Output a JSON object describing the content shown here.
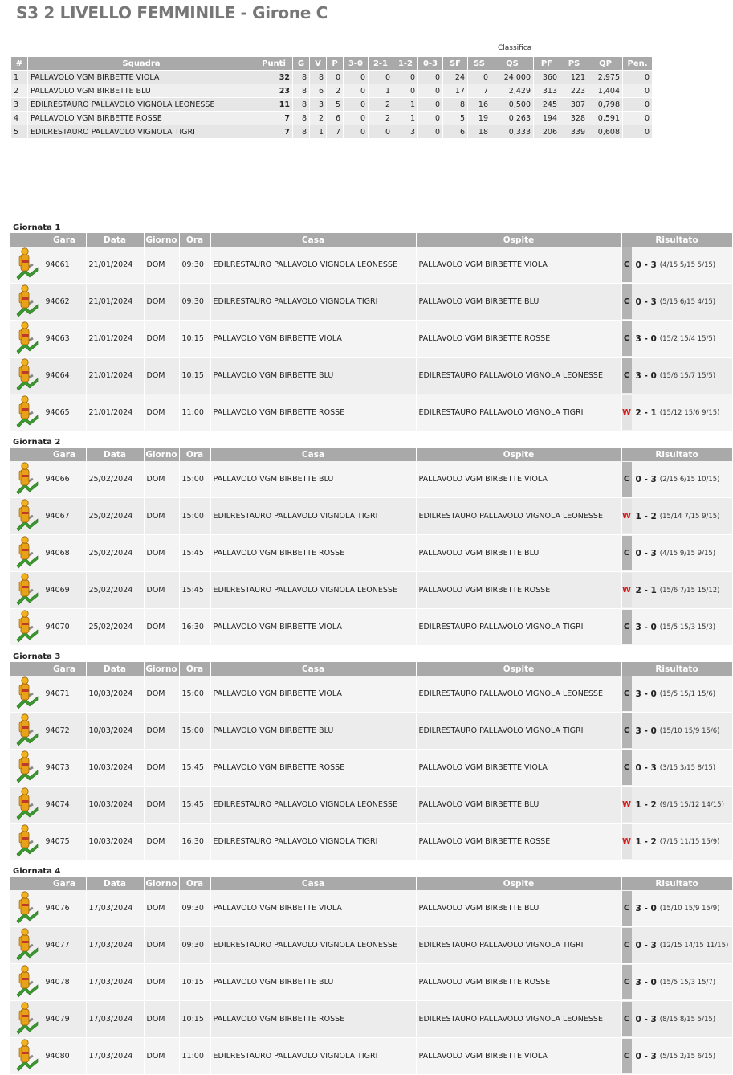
{
  "title": "S3 2 LIVELLO FEMMINILE - Girone C",
  "classifica": {
    "caption": "Classifica",
    "headers": [
      "#",
      "Squadra",
      "Punti",
      "G",
      "V",
      "P",
      "3-0",
      "2-1",
      "1-2",
      "0-3",
      "SF",
      "SS",
      "QS",
      "PF",
      "PS",
      "QP",
      "Pen."
    ],
    "rows": [
      [
        "1",
        "PALLAVOLO VGM BIRBETTE VIOLA",
        "32",
        "8",
        "8",
        "0",
        "0",
        "0",
        "0",
        "0",
        "24",
        "0",
        "24,000",
        "360",
        "121",
        "2,975",
        "0"
      ],
      [
        "2",
        "PALLAVOLO VGM BIRBETTE BLU",
        "23",
        "8",
        "6",
        "2",
        "0",
        "1",
        "0",
        "0",
        "17",
        "7",
        "2,429",
        "313",
        "223",
        "1,404",
        "0"
      ],
      [
        "3",
        "EDILRESTAURO PALLAVOLO VIGNOLA LEONESSE",
        "11",
        "8",
        "3",
        "5",
        "0",
        "2",
        "1",
        "0",
        "8",
        "16",
        "0,500",
        "245",
        "307",
        "0,798",
        "0"
      ],
      [
        "4",
        "PALLAVOLO VGM BIRBETTE ROSSE",
        "7",
        "8",
        "2",
        "6",
        "0",
        "2",
        "1",
        "0",
        "5",
        "19",
        "0,263",
        "194",
        "328",
        "0,591",
        "0"
      ],
      [
        "5",
        "EDILRESTAURO PALLAVOLO VIGNOLA TIGRI",
        "7",
        "8",
        "1",
        "7",
        "0",
        "0",
        "3",
        "0",
        "6",
        "18",
        "0,333",
        "206",
        "339",
        "0,608",
        "0"
      ]
    ]
  },
  "calendar_headers": [
    "",
    "Gara",
    "Data",
    "Giorno",
    "Ora",
    "Casa",
    "Ospite",
    "Risultato"
  ],
  "giornate": [
    {
      "title": "Giornata 1",
      "matches": [
        {
          "gara": "94061",
          "data": "21/01/2024",
          "giorno": "DOM",
          "ora": "09:30",
          "casa": "EDILRESTAURO PALLAVOLO VIGNOLA LEONESSE",
          "ospite": "PALLAVOLO VGM BIRBETTE VIOLA",
          "tag": "C",
          "score": "0 - 3",
          "sets": "(4/15 5/15 5/15)"
        },
        {
          "gara": "94062",
          "data": "21/01/2024",
          "giorno": "DOM",
          "ora": "09:30",
          "casa": "EDILRESTAURO PALLAVOLO VIGNOLA TIGRI",
          "ospite": "PALLAVOLO VGM BIRBETTE BLU",
          "tag": "C",
          "score": "0 - 3",
          "sets": "(5/15 6/15 4/15)"
        },
        {
          "gara": "94063",
          "data": "21/01/2024",
          "giorno": "DOM",
          "ora": "10:15",
          "casa": "PALLAVOLO VGM BIRBETTE VIOLA",
          "ospite": "PALLAVOLO VGM BIRBETTE ROSSE",
          "tag": "C",
          "score": "3 - 0",
          "sets": "(15/2 15/4 15/5)"
        },
        {
          "gara": "94064",
          "data": "21/01/2024",
          "giorno": "DOM",
          "ora": "10:15",
          "casa": "PALLAVOLO VGM BIRBETTE BLU",
          "ospite": "EDILRESTAURO PALLAVOLO VIGNOLA LEONESSE",
          "tag": "C",
          "score": "3 - 0",
          "sets": "(15/6 15/7 15/5)"
        },
        {
          "gara": "94065",
          "data": "21/01/2024",
          "giorno": "DOM",
          "ora": "11:00",
          "casa": "PALLAVOLO VGM BIRBETTE ROSSE",
          "ospite": "EDILRESTAURO PALLAVOLO VIGNOLA TIGRI",
          "tag": "W",
          "score": "2 - 1",
          "sets": "(15/12 15/6 9/15)"
        }
      ]
    },
    {
      "title": "Giornata 2",
      "matches": [
        {
          "gara": "94066",
          "data": "25/02/2024",
          "giorno": "DOM",
          "ora": "15:00",
          "casa": "PALLAVOLO VGM BIRBETTE BLU",
          "ospite": "PALLAVOLO VGM BIRBETTE VIOLA",
          "tag": "C",
          "score": "0 - 3",
          "sets": "(2/15 6/15 10/15)"
        },
        {
          "gara": "94067",
          "data": "25/02/2024",
          "giorno": "DOM",
          "ora": "15:00",
          "casa": "EDILRESTAURO PALLAVOLO VIGNOLA TIGRI",
          "ospite": "EDILRESTAURO PALLAVOLO VIGNOLA LEONESSE",
          "tag": "W",
          "score": "1 - 2",
          "sets": "(15/14 7/15 9/15)"
        },
        {
          "gara": "94068",
          "data": "25/02/2024",
          "giorno": "DOM",
          "ora": "15:45",
          "casa": "PALLAVOLO VGM BIRBETTE ROSSE",
          "ospite": "PALLAVOLO VGM BIRBETTE BLU",
          "tag": "C",
          "score": "0 - 3",
          "sets": "(4/15 9/15 9/15)"
        },
        {
          "gara": "94069",
          "data": "25/02/2024",
          "giorno": "DOM",
          "ora": "15:45",
          "casa": "EDILRESTAURO PALLAVOLO VIGNOLA LEONESSE",
          "ospite": "PALLAVOLO VGM BIRBETTE ROSSE",
          "tag": "W",
          "score": "2 - 1",
          "sets": "(15/6 7/15 15/12)"
        },
        {
          "gara": "94070",
          "data": "25/02/2024",
          "giorno": "DOM",
          "ora": "16:30",
          "casa": "PALLAVOLO VGM BIRBETTE VIOLA",
          "ospite": "EDILRESTAURO PALLAVOLO VIGNOLA TIGRI",
          "tag": "C",
          "score": "3 - 0",
          "sets": "(15/5 15/3 15/3)"
        }
      ]
    },
    {
      "title": "Giornata 3",
      "matches": [
        {
          "gara": "94071",
          "data": "10/03/2024",
          "giorno": "DOM",
          "ora": "15:00",
          "casa": "PALLAVOLO VGM BIRBETTE VIOLA",
          "ospite": "EDILRESTAURO PALLAVOLO VIGNOLA LEONESSE",
          "tag": "C",
          "score": "3 - 0",
          "sets": "(15/5 15/1 15/6)"
        },
        {
          "gara": "94072",
          "data": "10/03/2024",
          "giorno": "DOM",
          "ora": "15:00",
          "casa": "PALLAVOLO VGM BIRBETTE BLU",
          "ospite": "EDILRESTAURO PALLAVOLO VIGNOLA TIGRI",
          "tag": "C",
          "score": "3 - 0",
          "sets": "(15/10 15/9 15/6)"
        },
        {
          "gara": "94073",
          "data": "10/03/2024",
          "giorno": "DOM",
          "ora": "15:45",
          "casa": "PALLAVOLO VGM BIRBETTE ROSSE",
          "ospite": "PALLAVOLO VGM BIRBETTE VIOLA",
          "tag": "C",
          "score": "0 - 3",
          "sets": "(3/15 3/15 8/15)"
        },
        {
          "gara": "94074",
          "data": "10/03/2024",
          "giorno": "DOM",
          "ora": "15:45",
          "casa": "EDILRESTAURO PALLAVOLO VIGNOLA LEONESSE",
          "ospite": "PALLAVOLO VGM BIRBETTE BLU",
          "tag": "W",
          "score": "1 - 2",
          "sets": "(9/15 15/12 14/15)"
        },
        {
          "gara": "94075",
          "data": "10/03/2024",
          "giorno": "DOM",
          "ora": "16:30",
          "casa": "EDILRESTAURO PALLAVOLO VIGNOLA TIGRI",
          "ospite": "PALLAVOLO VGM BIRBETTE ROSSE",
          "tag": "W",
          "score": "1 - 2",
          "sets": "(7/15 11/15 15/9)"
        }
      ]
    },
    {
      "title": "Giornata 4",
      "matches": [
        {
          "gara": "94076",
          "data": "17/03/2024",
          "giorno": "DOM",
          "ora": "09:30",
          "casa": "PALLAVOLO VGM BIRBETTE VIOLA",
          "ospite": "PALLAVOLO VGM BIRBETTE BLU",
          "tag": "C",
          "score": "3 - 0",
          "sets": "(15/10 15/9 15/9)"
        },
        {
          "gara": "94077",
          "data": "17/03/2024",
          "giorno": "DOM",
          "ora": "09:30",
          "casa": "EDILRESTAURO PALLAVOLO VIGNOLA LEONESSE",
          "ospite": "EDILRESTAURO PALLAVOLO VIGNOLA TIGRI",
          "tag": "C",
          "score": "0 - 3",
          "sets": "(12/15 14/15 11/15)"
        },
        {
          "gara": "94078",
          "data": "17/03/2024",
          "giorno": "DOM",
          "ora": "10:15",
          "casa": "PALLAVOLO VGM BIRBETTE BLU",
          "ospite": "PALLAVOLO VGM BIRBETTE ROSSE",
          "tag": "C",
          "score": "3 - 0",
          "sets": "(15/5 15/3 15/7)"
        },
        {
          "gara": "94079",
          "data": "17/03/2024",
          "giorno": "DOM",
          "ora": "10:15",
          "casa": "PALLAVOLO VGM BIRBETTE ROSSE",
          "ospite": "EDILRESTAURO PALLAVOLO VIGNOLA LEONESSE",
          "tag": "C",
          "score": "0 - 3",
          "sets": "(8/15 8/15 5/15)"
        },
        {
          "gara": "94080",
          "data": "17/03/2024",
          "giorno": "DOM",
          "ora": "11:00",
          "casa": "EDILRESTAURO PALLAVOLO VIGNOLA TIGRI",
          "ospite": "PALLAVOLO VGM BIRBETTE VIOLA",
          "tag": "C",
          "score": "0 - 3",
          "sets": "(5/15 2/15 6/15)"
        }
      ]
    }
  ]
}
